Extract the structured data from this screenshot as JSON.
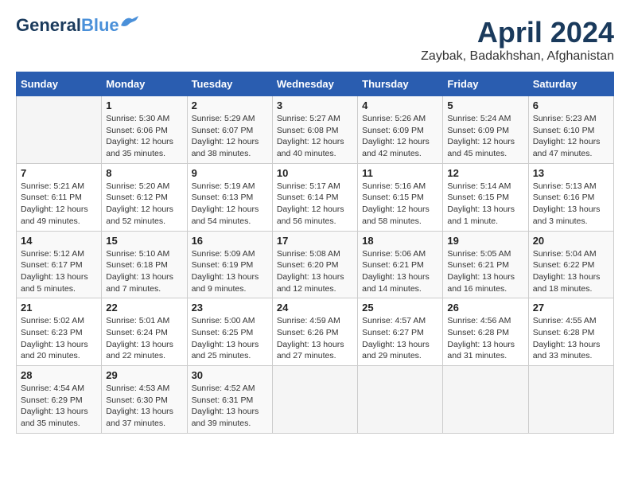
{
  "header": {
    "logo_line1": "General",
    "logo_line2": "Blue",
    "month": "April 2024",
    "location": "Zaybak, Badakhshan, Afghanistan"
  },
  "weekdays": [
    "Sunday",
    "Monday",
    "Tuesday",
    "Wednesday",
    "Thursday",
    "Friday",
    "Saturday"
  ],
  "weeks": [
    [
      {
        "day": "",
        "info": ""
      },
      {
        "day": "1",
        "info": "Sunrise: 5:30 AM\nSunset: 6:06 PM\nDaylight: 12 hours\nand 35 minutes."
      },
      {
        "day": "2",
        "info": "Sunrise: 5:29 AM\nSunset: 6:07 PM\nDaylight: 12 hours\nand 38 minutes."
      },
      {
        "day": "3",
        "info": "Sunrise: 5:27 AM\nSunset: 6:08 PM\nDaylight: 12 hours\nand 40 minutes."
      },
      {
        "day": "4",
        "info": "Sunrise: 5:26 AM\nSunset: 6:09 PM\nDaylight: 12 hours\nand 42 minutes."
      },
      {
        "day": "5",
        "info": "Sunrise: 5:24 AM\nSunset: 6:09 PM\nDaylight: 12 hours\nand 45 minutes."
      },
      {
        "day": "6",
        "info": "Sunrise: 5:23 AM\nSunset: 6:10 PM\nDaylight: 12 hours\nand 47 minutes."
      }
    ],
    [
      {
        "day": "7",
        "info": "Sunrise: 5:21 AM\nSunset: 6:11 PM\nDaylight: 12 hours\nand 49 minutes."
      },
      {
        "day": "8",
        "info": "Sunrise: 5:20 AM\nSunset: 6:12 PM\nDaylight: 12 hours\nand 52 minutes."
      },
      {
        "day": "9",
        "info": "Sunrise: 5:19 AM\nSunset: 6:13 PM\nDaylight: 12 hours\nand 54 minutes."
      },
      {
        "day": "10",
        "info": "Sunrise: 5:17 AM\nSunset: 6:14 PM\nDaylight: 12 hours\nand 56 minutes."
      },
      {
        "day": "11",
        "info": "Sunrise: 5:16 AM\nSunset: 6:15 PM\nDaylight: 12 hours\nand 58 minutes."
      },
      {
        "day": "12",
        "info": "Sunrise: 5:14 AM\nSunset: 6:15 PM\nDaylight: 13 hours\nand 1 minute."
      },
      {
        "day": "13",
        "info": "Sunrise: 5:13 AM\nSunset: 6:16 PM\nDaylight: 13 hours\nand 3 minutes."
      }
    ],
    [
      {
        "day": "14",
        "info": "Sunrise: 5:12 AM\nSunset: 6:17 PM\nDaylight: 13 hours\nand 5 minutes."
      },
      {
        "day": "15",
        "info": "Sunrise: 5:10 AM\nSunset: 6:18 PM\nDaylight: 13 hours\nand 7 minutes."
      },
      {
        "day": "16",
        "info": "Sunrise: 5:09 AM\nSunset: 6:19 PM\nDaylight: 13 hours\nand 9 minutes."
      },
      {
        "day": "17",
        "info": "Sunrise: 5:08 AM\nSunset: 6:20 PM\nDaylight: 13 hours\nand 12 minutes."
      },
      {
        "day": "18",
        "info": "Sunrise: 5:06 AM\nSunset: 6:21 PM\nDaylight: 13 hours\nand 14 minutes."
      },
      {
        "day": "19",
        "info": "Sunrise: 5:05 AM\nSunset: 6:21 PM\nDaylight: 13 hours\nand 16 minutes."
      },
      {
        "day": "20",
        "info": "Sunrise: 5:04 AM\nSunset: 6:22 PM\nDaylight: 13 hours\nand 18 minutes."
      }
    ],
    [
      {
        "day": "21",
        "info": "Sunrise: 5:02 AM\nSunset: 6:23 PM\nDaylight: 13 hours\nand 20 minutes."
      },
      {
        "day": "22",
        "info": "Sunrise: 5:01 AM\nSunset: 6:24 PM\nDaylight: 13 hours\nand 22 minutes."
      },
      {
        "day": "23",
        "info": "Sunrise: 5:00 AM\nSunset: 6:25 PM\nDaylight: 13 hours\nand 25 minutes."
      },
      {
        "day": "24",
        "info": "Sunrise: 4:59 AM\nSunset: 6:26 PM\nDaylight: 13 hours\nand 27 minutes."
      },
      {
        "day": "25",
        "info": "Sunrise: 4:57 AM\nSunset: 6:27 PM\nDaylight: 13 hours\nand 29 minutes."
      },
      {
        "day": "26",
        "info": "Sunrise: 4:56 AM\nSunset: 6:28 PM\nDaylight: 13 hours\nand 31 minutes."
      },
      {
        "day": "27",
        "info": "Sunrise: 4:55 AM\nSunset: 6:28 PM\nDaylight: 13 hours\nand 33 minutes."
      }
    ],
    [
      {
        "day": "28",
        "info": "Sunrise: 4:54 AM\nSunset: 6:29 PM\nDaylight: 13 hours\nand 35 minutes."
      },
      {
        "day": "29",
        "info": "Sunrise: 4:53 AM\nSunset: 6:30 PM\nDaylight: 13 hours\nand 37 minutes."
      },
      {
        "day": "30",
        "info": "Sunrise: 4:52 AM\nSunset: 6:31 PM\nDaylight: 13 hours\nand 39 minutes."
      },
      {
        "day": "",
        "info": ""
      },
      {
        "day": "",
        "info": ""
      },
      {
        "day": "",
        "info": ""
      },
      {
        "day": "",
        "info": ""
      }
    ]
  ]
}
